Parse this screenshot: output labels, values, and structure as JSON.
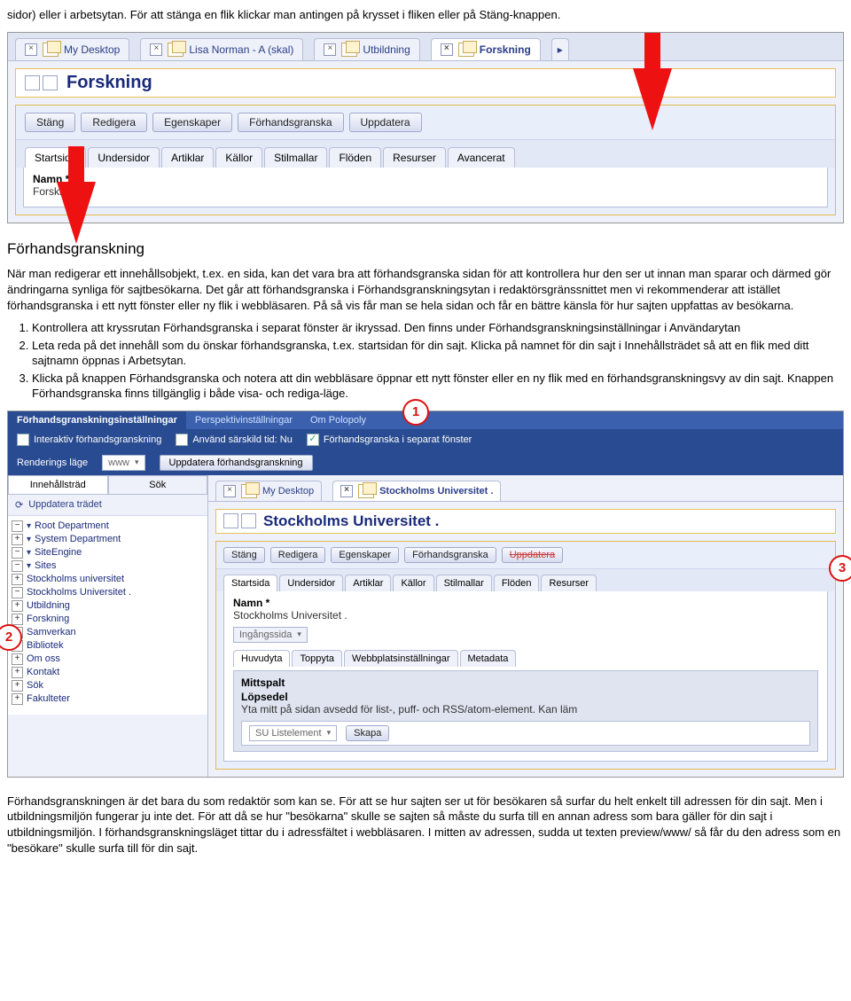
{
  "doc": {
    "intro": "sidor) eller i arbetsytan. För att stänga en flik klickar man antingen på krysset i fliken eller på Stäng-knappen.",
    "section_head": "Förhandsgranskning",
    "para1": "När man redigerar ett innehållsobjekt, t.ex. en sida, kan det vara bra att förhandsgranska sidan för att kontrollera hur den ser ut innan man sparar och därmed gör ändringarna synliga för sajtbesökarna. Det går att förhandsgranska i Förhandsgranskningsytan i redaktörsgränssnittet men vi rekommenderar att istället förhandsgranska i ett nytt fönster eller ny flik i webbläsaren. På så vis får man se hela sidan och får en bättre känsla för hur sajten uppfattas av besökarna.",
    "steps": [
      "Kontrollera att kryssrutan Förhandsgranska i separat fönster är ikryssad. Den finns under Förhandsgranskningsinställningar i Användarytan",
      "Leta reda på det innehåll som du önskar förhandsgranska, t.ex. startsidan för din sajt. Klicka på namnet för din sajt i Innehållsträdet så att en flik med ditt sajtnamn öppnas i Arbetsytan.",
      "Klicka på knappen Förhandsgranska och notera att din webbläsare öppnar ett nytt fönster eller en ny flik med en förhandsgranskningsvy av din sajt. Knappen Förhandsgranska finns tillgänglig i både visa- och rediga-läge."
    ],
    "outro": "Förhandsgranskningen är det bara du som redaktör som kan se. För att se hur sajten ser ut för besökaren så surfar du helt enkelt till adressen för din sajt. Men i utbildningsmiljön fungerar ju inte det. För att då se hur \"besökarna\" skulle se sajten så måste du surfa till en annan adress som bara gäller för din sajt i utbildningsmiljön. I förhandsgranskningsläget tittar du i adressfältet i webbläsaren. I mitten av adressen, sudda ut texten preview/www/ så får du den adress som en \"besökare\" skulle surfa till för din sajt."
  },
  "shot1": {
    "tabs": [
      "My Desktop",
      "Lisa Norman - A (skal)",
      "Utbildning",
      "Forskning"
    ],
    "title": "Forskning",
    "buttons": [
      "Stäng",
      "Redigera",
      "Egenskaper",
      "Förhandsgranska",
      "Uppdatera"
    ],
    "subtabs": [
      "Startsida",
      "Undersidor",
      "Artiklar",
      "Källor",
      "Stilmallar",
      "Flöden",
      "Resurser",
      "Avancerat"
    ],
    "name_label": "Namn *",
    "name_value": "Forskning"
  },
  "shot2": {
    "settings_tabs": [
      "Förhandsgranskningsinställningar",
      "Perspektivinställningar",
      "Om Polopoly"
    ],
    "cb_interactive": "Interaktiv förhandsgranskning",
    "cb_time": "Använd särskild tid: Nu",
    "cb_separate": "Förhandsgranska i separat fönster",
    "render_label": "Renderings läge",
    "render_value": "www",
    "update_btn": "Uppdatera förhandsgranskning",
    "left_tabs": [
      "Innehållsträd",
      "Sök"
    ],
    "update_tree": "Uppdatera trädet",
    "tree": {
      "root": "Root Department",
      "sys": "System Department",
      "siteengine": "SiteEngine",
      "sites": "Sites",
      "items": [
        "Stockholms universitet",
        "Stockholms Universitet .",
        "Utbildning",
        "Forskning",
        "Samverkan",
        "Bibliotek",
        "Om oss",
        "Kontakt",
        "Sök",
        "Fakulteter"
      ]
    },
    "right_tabs": [
      "My Desktop",
      "Stockholms Universitet ."
    ],
    "right_title": "Stockholms Universitet .",
    "right_buttons": [
      "Stäng",
      "Redigera",
      "Egenskaper",
      "Förhandsgranska",
      "Uppdatera"
    ],
    "right_subtabs": [
      "Startsida",
      "Undersidor",
      "Artiklar",
      "Källor",
      "Stilmallar",
      "Flöden",
      "Resurser"
    ],
    "name_label": "Namn *",
    "name_value": "Stockholms Universitet .",
    "sel_value": "Ingångssida",
    "inner_tabs": [
      "Huvudyta",
      "Toppyta",
      "Webbplatsinställningar",
      "Metadata"
    ],
    "panel_head": "Mittspalt",
    "panel_sub": "Löpsedel",
    "panel_text": "Yta mitt på sidan avsedd för list-, puff- och RSS/atom-element. Kan läm",
    "list_item": "SU Listelement",
    "skapa": "Skapa"
  },
  "markers": {
    "m1": "1",
    "m2": "2",
    "m3": "3"
  }
}
